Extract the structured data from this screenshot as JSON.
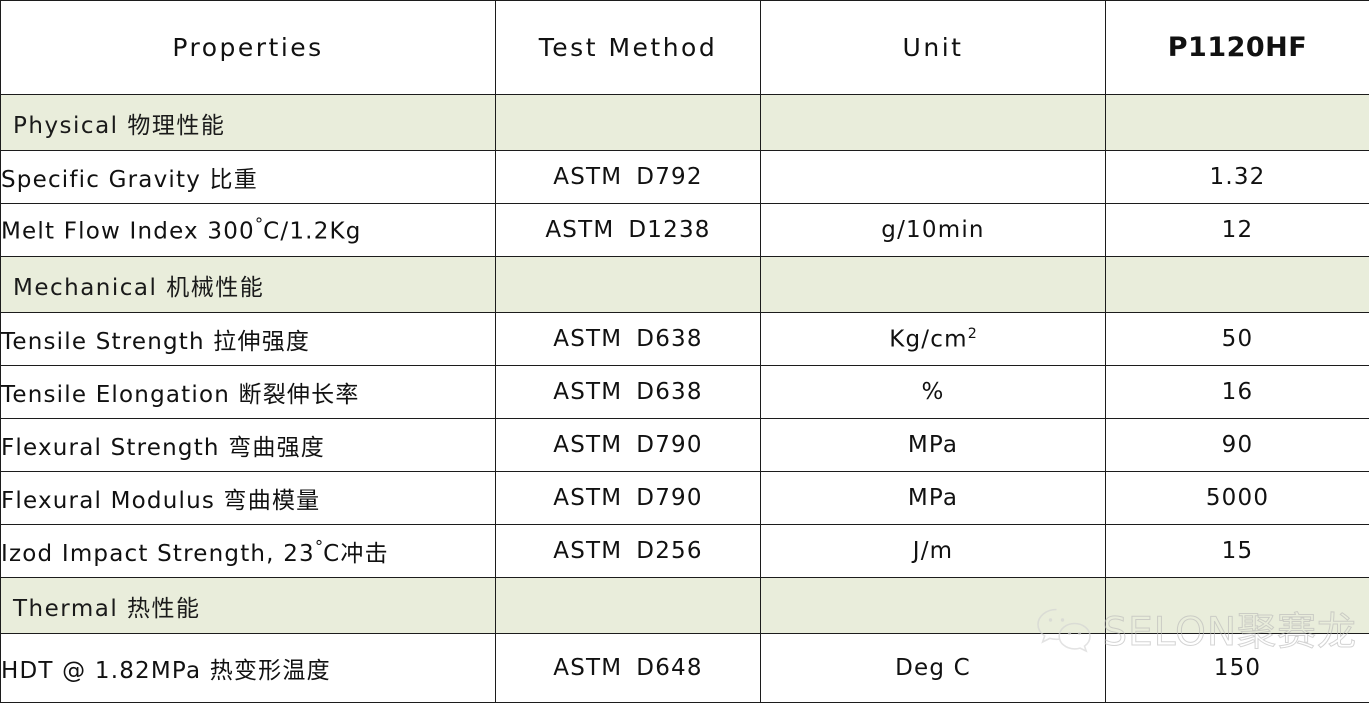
{
  "table": {
    "columns": [
      {
        "key": "property",
        "label": "Properties"
      },
      {
        "key": "method",
        "label": "Test Method"
      },
      {
        "key": "unit",
        "label": "Unit"
      },
      {
        "key": "value",
        "label": "P1120HF"
      }
    ],
    "rows": [
      {
        "type": "section",
        "property": "Physical 物理性能",
        "method": "",
        "unit": "",
        "value": ""
      },
      {
        "type": "data",
        "property": "Specific Gravity 比重",
        "method_agency": "ASTM",
        "method_code": "D792",
        "unit": "",
        "value": "1.32"
      },
      {
        "type": "data",
        "property": "Melt Flow Index 300",
        "property_deg": "°",
        "property_tail": "C/1.2Kg",
        "method_agency": "ASTM",
        "method_code": "D1238",
        "unit": "g/10min",
        "value": "12"
      },
      {
        "type": "section",
        "property": "Mechanical 机械性能",
        "method": "",
        "unit": "",
        "value": ""
      },
      {
        "type": "data",
        "property": "Tensile Strength 拉伸强度",
        "method_agency": "ASTM",
        "method_code": "D638",
        "unit": "Kg/cm",
        "unit_sup": "2",
        "value": "50"
      },
      {
        "type": "data",
        "property": "Tensile Elongation 断裂伸长率",
        "method_agency": "ASTM",
        "method_code": "D638",
        "unit": "%",
        "value": "16"
      },
      {
        "type": "data",
        "property": "Flexural Strength 弯曲强度",
        "method_agency": "ASTM",
        "method_code": "D790",
        "unit": "MPa",
        "value": "90"
      },
      {
        "type": "data",
        "property": "Flexural Modulus 弯曲模量",
        "method_agency": "ASTM",
        "method_code": "D790",
        "unit": "MPa",
        "value": "5000"
      },
      {
        "type": "data",
        "property": "Izod Impact Strength, 23",
        "property_deg": "°",
        "property_tail": "C冲击",
        "method_agency": "ASTM",
        "method_code": "D256",
        "unit": "J/m",
        "value": "15"
      },
      {
        "type": "section",
        "property": "Thermal 热性能",
        "method": "",
        "unit": "",
        "value": ""
      },
      {
        "type": "data",
        "property": "HDT @ 1.82MPa  热变形温度",
        "method_agency": "ASTM",
        "method_code": "D648",
        "unit": "Deg C",
        "value": "150"
      }
    ]
  },
  "watermark": {
    "text": "SELON聚赛龙",
    "icon": "wechat-icon"
  },
  "colors": {
    "section_background": "#E9EDDB",
    "border": "#1C1C1C",
    "text": "#111111",
    "watermark_stroke": "#B9B9B9"
  }
}
